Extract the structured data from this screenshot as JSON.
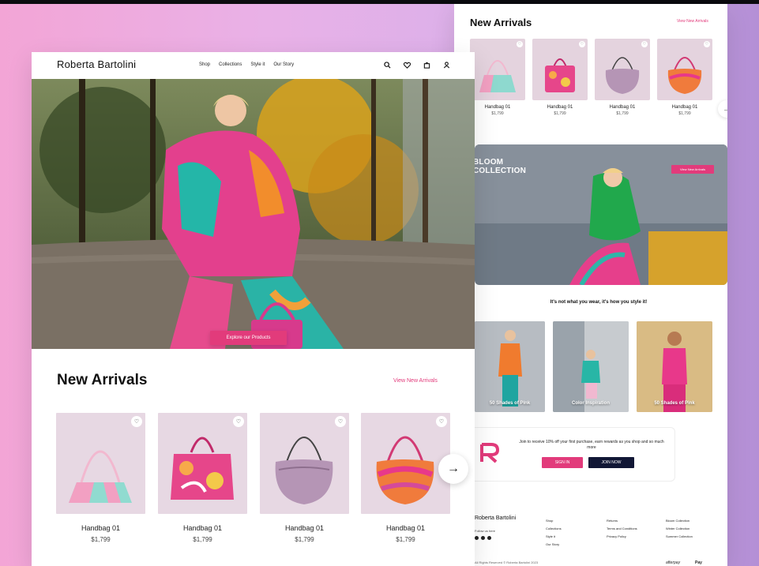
{
  "colors": {
    "accent": "#e23b7b",
    "dark": "#111735"
  },
  "back": {
    "new_arrivals": {
      "title": "New Arrivals",
      "view_link": "View New Arrivals",
      "products": [
        {
          "name": "Handbag 01",
          "price": "$1,799"
        },
        {
          "name": "Handbag 01",
          "price": "$1,799"
        },
        {
          "name": "Handbag 01",
          "price": "$1,799"
        },
        {
          "name": "Handbag 01",
          "price": "$1,799"
        }
      ]
    },
    "bloom": {
      "title": "BLOOM COLLECTION",
      "button": "View New Arrivals"
    },
    "tagline": "It's not what you wear, it's how you style it!",
    "lookbook": [
      "50 Shades of Pink",
      "Color Inspiration",
      "50 Shades of Pink"
    ],
    "signup": {
      "text": "Join to receive 10% off your first purchase, earn rewards as you shop and so much more",
      "sign_in": "SIGN IN",
      "join_now": "JOIN NOW"
    },
    "footer": {
      "brand": "Roberta Bartolini",
      "follow": "Follow us here",
      "col1": [
        "Shop",
        "Collections",
        "Style it",
        "Our Story"
      ],
      "col2": [
        "Returns",
        "Terms and Conditions",
        "Privacy Policy"
      ],
      "col3": [
        "Bloom Collection",
        "Winter Collection",
        "Summer Collection"
      ],
      "copyright": "All Rights Reserved © Roberta Bartolini 2023",
      "pay1": "afterpay",
      "pay2": "Pay"
    }
  },
  "front": {
    "brand": "Roberta Bartolini",
    "nav": [
      "Shop",
      "Collections",
      "Style it",
      "Our Story"
    ],
    "icons": [
      "search-icon",
      "heart-icon",
      "bag-icon",
      "user-icon"
    ],
    "hero_button": "Explore our Products",
    "new_arrivals": {
      "title": "New Arrivals",
      "view_link": "View New Arrivals",
      "products": [
        {
          "name": "Handbag 01",
          "price": "$1,799"
        },
        {
          "name": "Handbag 01",
          "price": "$1,799"
        },
        {
          "name": "Handbag 01",
          "price": "$1,799"
        },
        {
          "name": "Handbag 01",
          "price": "$1,799"
        }
      ]
    }
  }
}
